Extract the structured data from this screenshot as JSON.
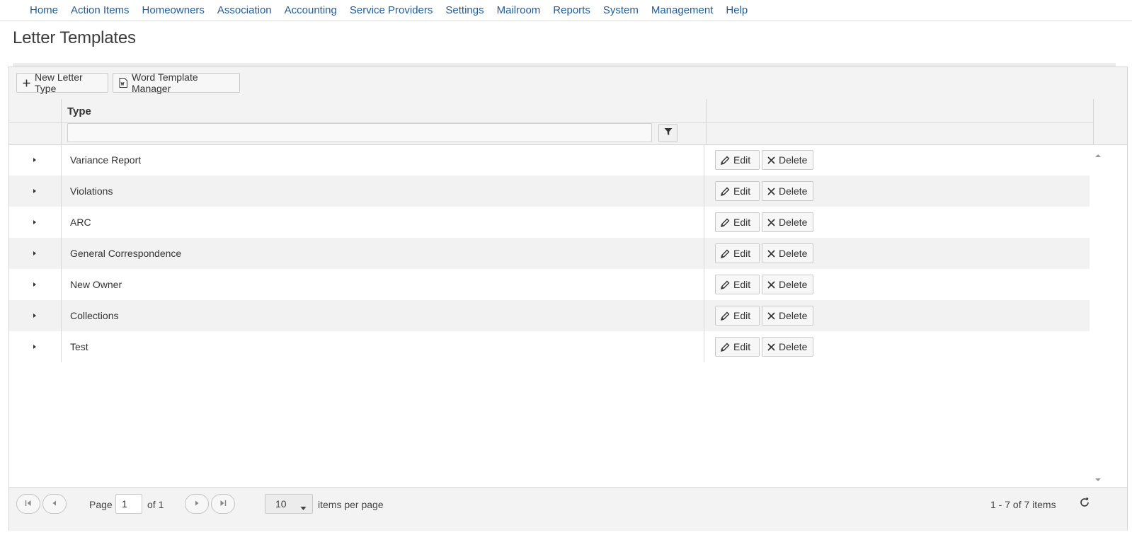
{
  "nav": {
    "items": [
      "Home",
      "Action Items",
      "Homeowners",
      "Association",
      "Accounting",
      "Service Providers",
      "Settings",
      "Mailroom",
      "Reports",
      "System",
      "Management",
      "Help"
    ]
  },
  "page": {
    "title": "Letter Templates"
  },
  "toolbar": {
    "new_label": "New Letter Type",
    "word_label": "Word Template Manager"
  },
  "grid": {
    "column_header": "Type",
    "filter_value": "",
    "rows": [
      {
        "type": "Variance Report"
      },
      {
        "type": "Violations"
      },
      {
        "type": "ARC"
      },
      {
        "type": "General Correspondence"
      },
      {
        "type": "New Owner"
      },
      {
        "type": "Collections"
      },
      {
        "type": "Test"
      }
    ],
    "edit_label": "Edit",
    "delete_label": "Delete"
  },
  "pager": {
    "page_label": "Page",
    "page_value": "1",
    "of_label": "of 1",
    "page_size": "10",
    "items_per_page_label": "items per page",
    "summary": "1 - 7 of 7 items"
  },
  "colors": {
    "nav_link": "#1f5c99",
    "toolbar_bg": "#f3f3f3",
    "alt_row": "#f2f2f2"
  }
}
